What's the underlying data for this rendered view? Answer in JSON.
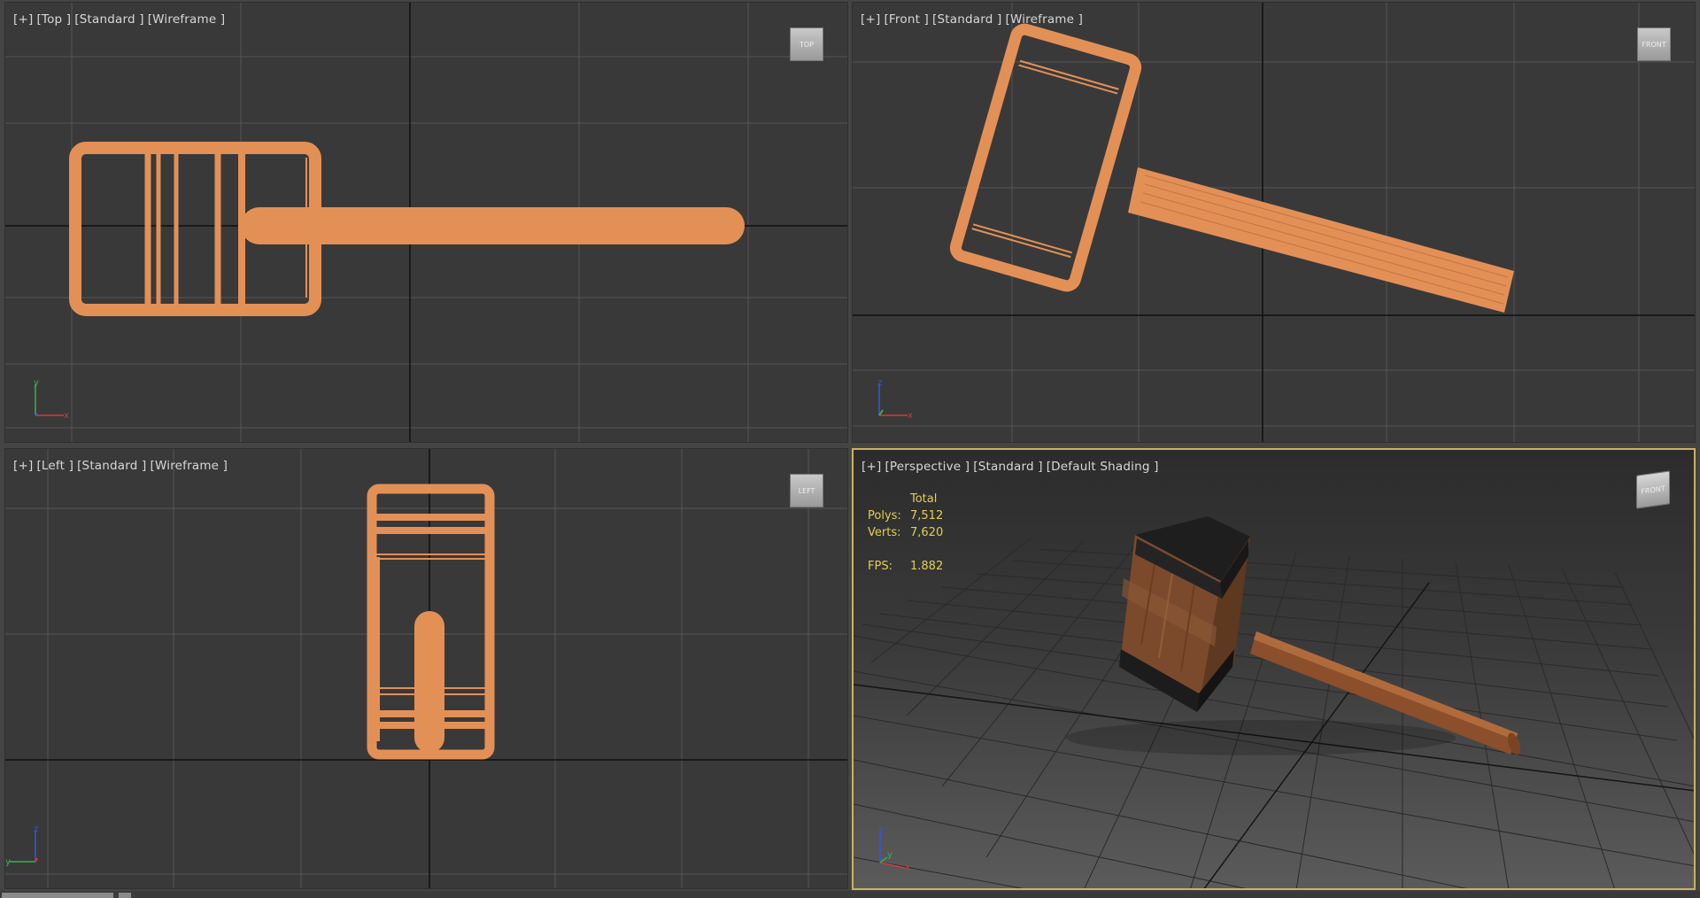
{
  "colors": {
    "viewport_bg": "#393939",
    "grid": "#555555",
    "axis": "#111111",
    "wire": "#e39057",
    "active_border": "#c9b35d",
    "stats_text": "#e3cf52"
  },
  "viewports": {
    "top": {
      "label": [
        "[+]",
        "[Top ]",
        "[Standard ]",
        "[Wireframe ]"
      ],
      "cube": "TOP"
    },
    "front": {
      "label": [
        "[+]",
        "[Front ]",
        "[Standard ]",
        "[Wireframe ]"
      ],
      "cube": "FRONT"
    },
    "left": {
      "label": [
        "[+]",
        "[Left ]",
        "[Standard ]",
        "[Wireframe ]"
      ],
      "cube": "LEFT"
    },
    "perspective": {
      "label": [
        "[+]",
        "[Perspective ]",
        "[Standard ]",
        "[Default Shading ]"
      ],
      "cube": "FRONT"
    }
  },
  "stats": {
    "header": "Total",
    "polys_label": "Polys:",
    "polys_value": "7,512",
    "verts_label": "Verts:",
    "verts_value": "7,620",
    "fps_label": "FPS:",
    "fps_value": "1.882"
  },
  "gizmo_axes": {
    "x": "x",
    "y": "y",
    "z": "z"
  }
}
